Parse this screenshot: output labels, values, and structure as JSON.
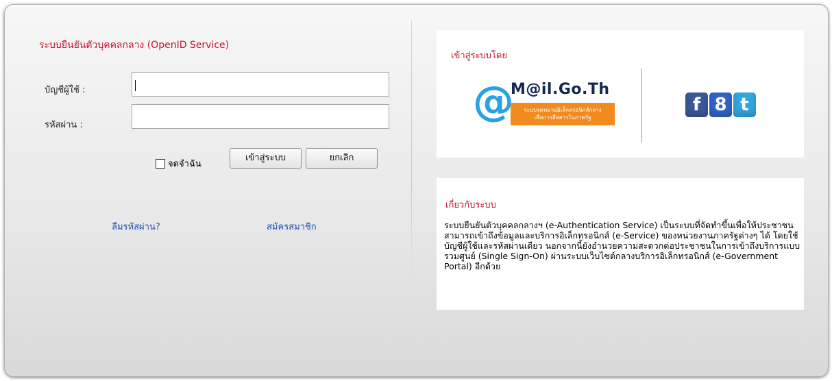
{
  "openid": {
    "title": "ระบบยืนยันตัวบุคคลกลาง (OpenID Service)",
    "username_label": "บัญชีผู้ใช้ :",
    "username_value": "",
    "password_label": "รหัสผ่าน :",
    "password_value": "",
    "remember_label": "จดจำฉัน",
    "login_button": "เข้าสู่ระบบ",
    "cancel_button": "ยกเลิก",
    "forgot_link": "ลืมรหัสผ่าน?",
    "register_link": "สมัครสมาชิก"
  },
  "login_with": {
    "title": "เข้าสู่ระบบโดย",
    "mail_logo_name": "M@il.Go.Th",
    "mail_logo_line1": "ระบบจดหมายอิเล็กทรอนิกส์กลาง",
    "mail_logo_line2": "เพื่อการสื่อสารในภาครัฐ",
    "social_icons": [
      "facebook-icon",
      "google-icon",
      "twitter-icon"
    ],
    "facebook_glyph": "f",
    "google_glyph": "8",
    "twitter_glyph": "t"
  },
  "about": {
    "title": "เกี่ยวกับระบบ",
    "body": "ระบบยืนยันตัวบุคคลกลางฯ (e-Authentication Service) เป็นระบบที่จัดทำขึ้นเพื่อให้ประชาชนสามารถเข้าถึงข้อมูลและบริการอิเล็กทรอนิกส์ (e-Service) ของหน่วยงานภาครัฐต่างๆ ได้ โดยใช้บัญชีผู้ใช้และรหัสผ่านเดียว นอกจากนี้ยังอำนวยความสะดวกต่อประชาชนในการเข้าถึงบริการแบบรวมศูนย์ (Single Sign-On) ผ่านระบบเว็บไซต์กลางบริการอิเล็กทรอนิกส์ (e-Government Portal) อีกด้วย"
  },
  "colors": {
    "accent_red": "#c8102e",
    "link_blue": "#1e4fb5",
    "logo_orange": "#f28a1e",
    "facebook": "#3b5998",
    "google": "#2f64c8",
    "twitter": "#33a8e0"
  }
}
